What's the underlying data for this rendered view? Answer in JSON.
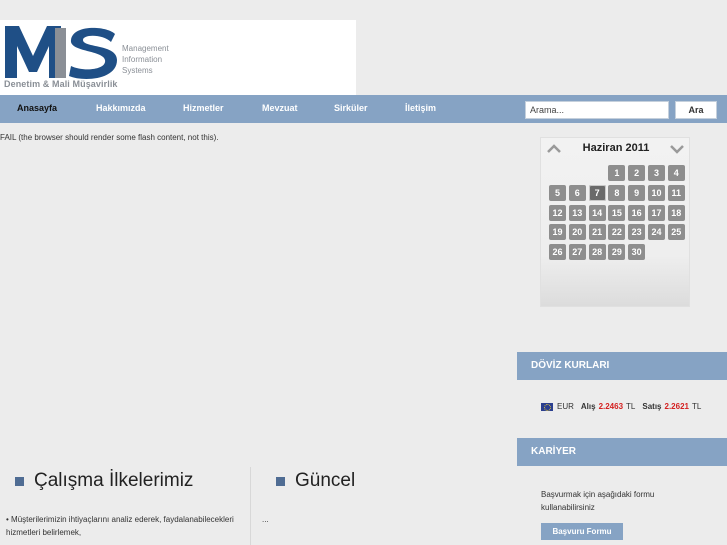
{
  "logo": {
    "mark": "MIS",
    "subtitle": "Denetim & Mali Müşavirlik",
    "tagline": [
      "Management",
      "Information",
      "Systems"
    ]
  },
  "nav": {
    "items": [
      "Anasayfa",
      "Hakkımızda",
      "Hizmetler",
      "Mevzuat",
      "Sirküler",
      "İletişim"
    ],
    "active": "Anasayfa"
  },
  "search": {
    "placeholder": "Arama...",
    "value": "Arama...",
    "button": "Ara"
  },
  "flash_fail": "FAIL (the browser should render some flash content, not this).",
  "calendar": {
    "title": "Haziran 2011",
    "days": [
      1,
      2,
      3,
      4,
      5,
      6,
      7,
      8,
      9,
      10,
      11,
      12,
      13,
      14,
      15,
      16,
      17,
      18,
      19,
      20,
      21,
      22,
      23,
      24,
      25,
      26,
      27,
      28,
      29,
      30
    ],
    "first_weekday_index": 3,
    "today": 7
  },
  "doviz": {
    "title": "DÖVİZ KURLARI",
    "currency": "EUR",
    "buy_label": "Alış",
    "buy_value": "2.2463",
    "sell_label": "Satış",
    "sell_value": "2.2621",
    "unit": "TL"
  },
  "kariyer": {
    "title": "KARİYER",
    "text": "Başvurmak için aşağıdaki formu kullanabilirsiniz",
    "button": "Başvuru Formu"
  },
  "sections": {
    "principles": {
      "title": "Çalışma İlkelerimiz",
      "text": "• Müşterilerimizin ihtiyaçlarını analiz ederek, faydalanabilecekleri hizmetleri belirlemek,"
    },
    "news": {
      "title": "Güncel",
      "text": "..."
    }
  },
  "colors": {
    "nav": "#86a3c4",
    "logo_blue": "#1f4f86",
    "logo_gray": "#8a8f96",
    "accent_red": "#d42020"
  }
}
